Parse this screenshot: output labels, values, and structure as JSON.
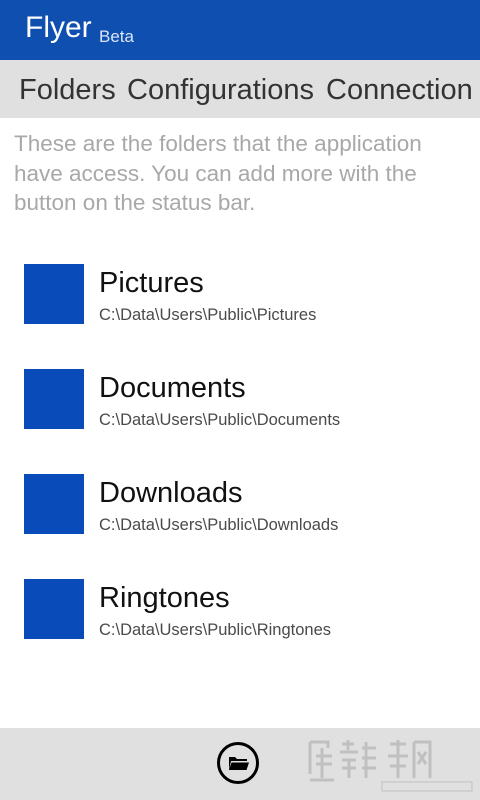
{
  "header": {
    "title": "Flyer",
    "badge": "Beta",
    "background": "#0e4fb0"
  },
  "tabs": [
    {
      "label": "Folders"
    },
    {
      "label": "Configurations"
    },
    {
      "label": "Connection"
    }
  ],
  "intro_text": "These are the folders that the application have access. You can add more with the button on the status bar.",
  "folders": [
    {
      "name": "Pictures",
      "path": "C:\\Data\\Users\\Public\\Pictures",
      "tile_color": "#0a4bba"
    },
    {
      "name": "Documents",
      "path": "C:\\Data\\Users\\Public\\Documents",
      "tile_color": "#0a4bba"
    },
    {
      "name": "Downloads",
      "path": "C:\\Data\\Users\\Public\\Downloads",
      "tile_color": "#0a4bba"
    },
    {
      "name": "Ringtones",
      "path": "C:\\Data\\Users\\Public\\Ringtones",
      "tile_color": "#0a4bba"
    }
  ],
  "app_bar": {
    "button_icon": "folder-open-icon"
  },
  "watermark": {
    "label": "新锋网",
    "url": "WWW.XAPCN.COM"
  }
}
